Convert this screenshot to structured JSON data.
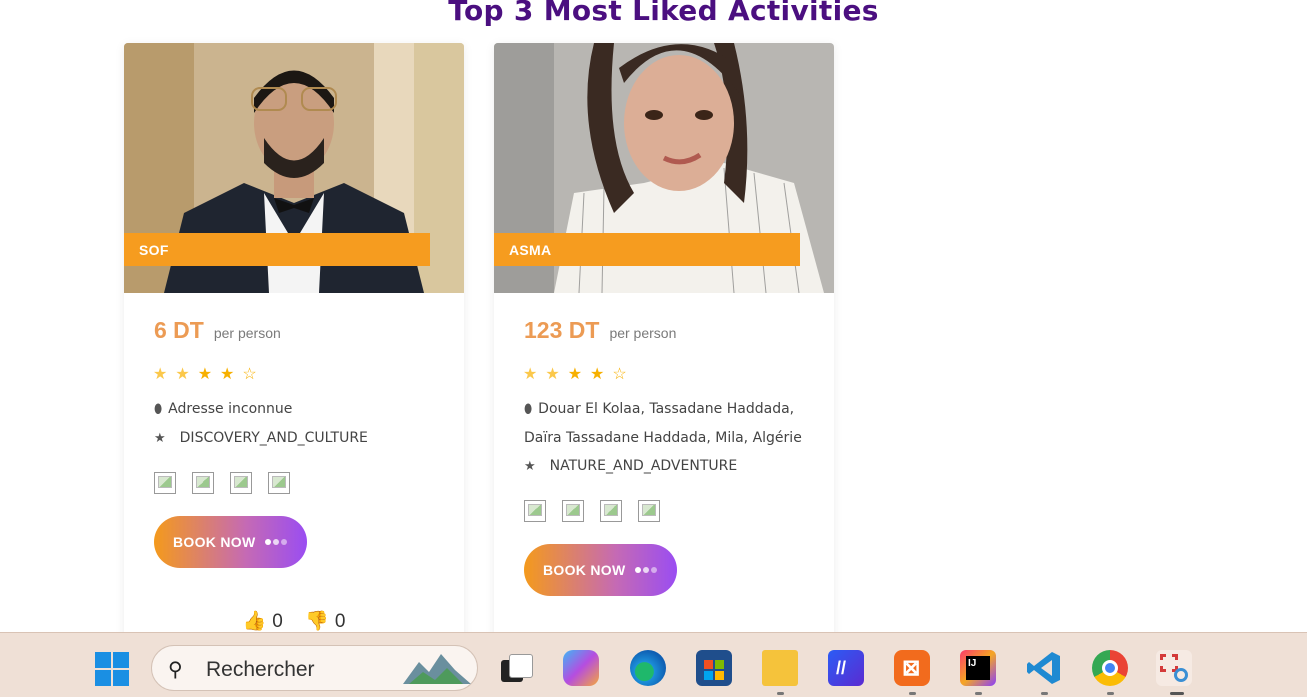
{
  "title": "Top 3 Most Liked Activities",
  "cards": [
    {
      "name": "SOF",
      "price": "6 DT",
      "per_person": "per person",
      "rating": 4,
      "address_lines": [
        "Adresse inconnue"
      ],
      "category": "DISCOVERY_AND_CULTURE",
      "book_label": "BOOK NOW",
      "likes": "0",
      "dislikes": "0"
    },
    {
      "name": "ASMA",
      "price": "123 DT",
      "per_person": "per person",
      "rating": 4,
      "address_lines": [
        "Douar El Kolaa, Tassadane Haddada,",
        "Daïra Tassadane Haddada, Mila, Algérie"
      ],
      "category": "NATURE_AND_ADVENTURE",
      "book_label": "BOOK NOW"
    }
  ],
  "taskbar": {
    "search_placeholder": "Rechercher",
    "apps": [
      "windows-start-icon",
      "task-view-icon",
      "copilot-icon",
      "edge-icon",
      "store-icon",
      "file-explorer-icon",
      "app-icon",
      "xampp-icon",
      "intellij-icon",
      "vscode-icon",
      "chrome-icon",
      "snipping-tool-icon"
    ]
  },
  "colors": {
    "title": "#4b0f80",
    "name_tag": "#f69c1f",
    "price": "#ec9b54",
    "button_start": "#f49a1c",
    "button_end": "#9a4df2"
  }
}
